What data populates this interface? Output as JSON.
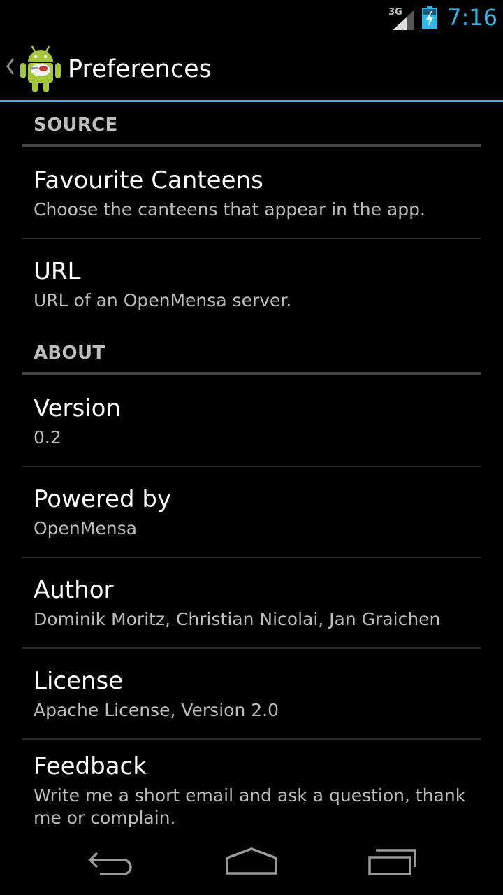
{
  "status": {
    "network": "3G",
    "time": "7:16"
  },
  "actionbar": {
    "title": "Preferences"
  },
  "sections": [
    {
      "header": "SOURCE",
      "items": [
        {
          "title": "Favourite Canteens",
          "summary": "Choose the canteens that appear in the app."
        },
        {
          "title": "URL",
          "summary": "URL of an OpenMensa server."
        }
      ]
    },
    {
      "header": "ABOUT",
      "items": [
        {
          "title": "Version",
          "summary": "0.2"
        },
        {
          "title": "Powered by",
          "summary": "OpenMensa"
        },
        {
          "title": "Author",
          "summary": "Dominik Moritz, Christian Nicolai, Jan Graichen"
        },
        {
          "title": "License",
          "summary": "Apache License, Version 2.0"
        },
        {
          "title": "Feedback",
          "summary": "Write me a short email and ask a question, thank me or complain."
        }
      ]
    }
  ],
  "icons": {
    "up": "chevron-left-icon",
    "app": "android-icon",
    "back": "back-icon",
    "home": "home-icon",
    "recents": "recents-icon"
  },
  "colors": {
    "accent": "#33b5e5",
    "background": "#000000",
    "summary": "#bdbdbd"
  }
}
